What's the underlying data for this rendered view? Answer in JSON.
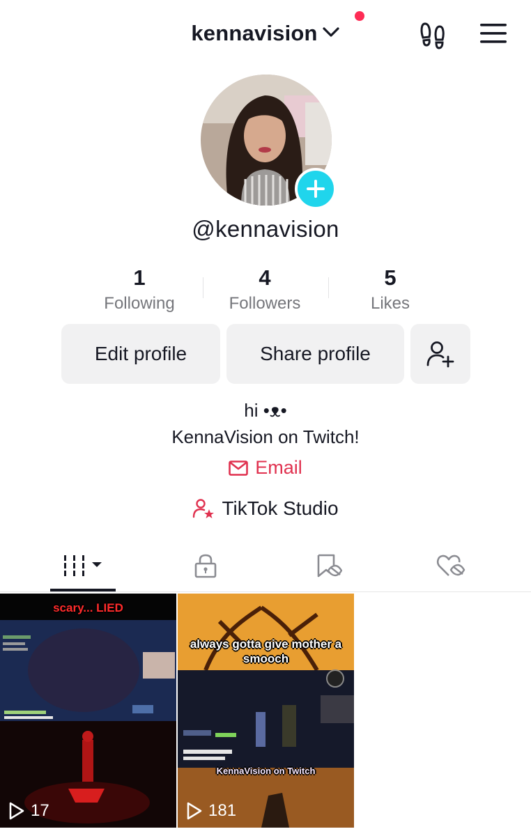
{
  "header": {
    "username": "kennavision",
    "has_notification_dot": true,
    "accent": "#fe2c55"
  },
  "profile": {
    "handle": "@kennavision",
    "stats": [
      {
        "value": "1",
        "label": "Following"
      },
      {
        "value": "4",
        "label": "Followers"
      },
      {
        "value": "5",
        "label": "Likes"
      }
    ],
    "buttons": {
      "edit": "Edit profile",
      "share": "Share profile"
    },
    "bio": {
      "line1": "hi •ᴥ•",
      "line2": "KennaVision on Twitch!"
    },
    "email_label": "Email",
    "studio_label": "TikTok Studio"
  },
  "tabs": [
    {
      "icon": "grid-icon",
      "selected": true
    },
    {
      "icon": "lock-icon",
      "selected": false
    },
    {
      "icon": "bookmark-hidden-icon",
      "selected": false
    },
    {
      "icon": "heart-hidden-icon",
      "selected": false
    }
  ],
  "videos": [
    {
      "caption_top": "scary... LIED",
      "views": "17"
    },
    {
      "caption_top": "always gotta give mother a smooch",
      "caption_bottom": "KennaVision on Twitch",
      "views": "181"
    }
  ],
  "colors": {
    "email": "#e0314f",
    "plus_badge": "#20d5ec",
    "button_bg": "#f1f1f2"
  }
}
